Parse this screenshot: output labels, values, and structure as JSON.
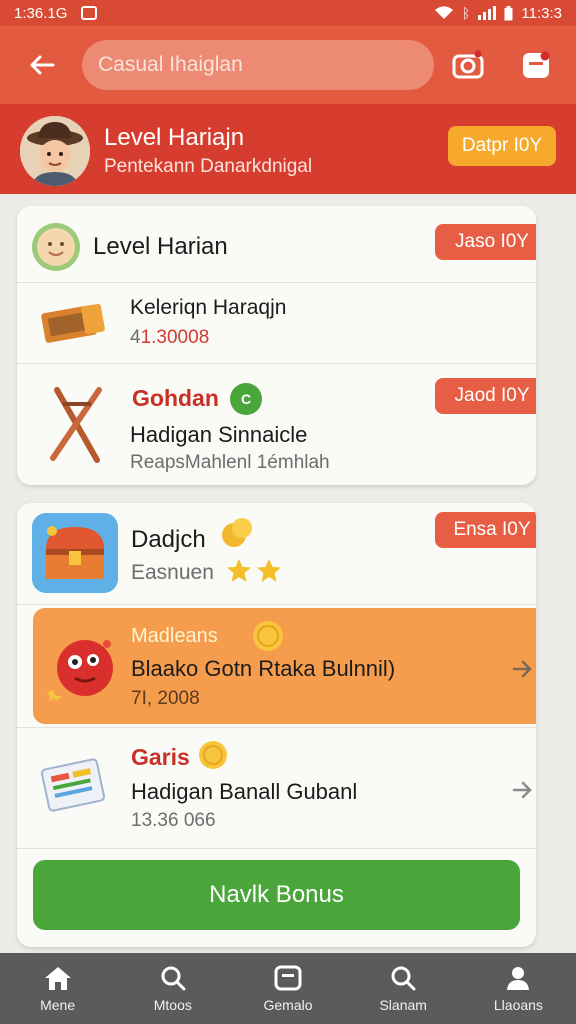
{
  "status_bar": {
    "time": "1:36.1G",
    "clock": "11:3:3"
  },
  "top_bar": {
    "search_placeholder": "Casual Ihaiglan",
    "icons": [
      "back-arrow-icon",
      "camera-icon",
      "notification-icon"
    ]
  },
  "profile": {
    "title": "Level Hariajn",
    "subtitle": "Pentekann Danarkdnigal",
    "button_label": "Datpr I0Y"
  },
  "card1": {
    "header": {
      "title": "Level Harian",
      "button_label": "Jaso I0Y"
    },
    "rows": [
      {
        "title": "Keleriqn Haraqjn",
        "value_prefix": "4",
        "value": "1.30008"
      },
      {
        "red_title": "Gohdan",
        "badge": "C",
        "title": "Hadigan Sinnaicle",
        "subtitle": "ReapsMahlenl 1émhlah",
        "button_label": "Jaod I0Y"
      }
    ]
  },
  "card2": {
    "header": {
      "title": "Dadjch",
      "subtitle": "Easnuen",
      "button_label": "Ensa I0Y"
    },
    "rows": [
      {
        "orange_title": "Madleans",
        "title": "Blaako Gotn Rtaka Bulnnil)",
        "value": "7I, 2008"
      },
      {
        "red_title": "Garis",
        "title": "Hadigan  Banall Gubanl",
        "value": "13.36 066"
      }
    ],
    "bonus_button": "Navlk Bonus"
  },
  "bottom_nav": [
    {
      "label": "Mene",
      "icon": "home-icon"
    },
    {
      "label": "Mtoos",
      "icon": "search-icon"
    },
    {
      "label": "Gemalo",
      "icon": "games-icon"
    },
    {
      "label": "Slanam",
      "icon": "explore-icon"
    },
    {
      "label": "Llaoans",
      "icon": "profile-icon"
    }
  ],
  "colors": {
    "header_red": "#e25a3f",
    "banner_red": "#d63d2f",
    "button_red": "#e85e45",
    "gold": "#f6a92c",
    "highlight_orange": "#f59d4c",
    "green": "#4aa63a",
    "nav_gray": "#5b5b5b"
  }
}
